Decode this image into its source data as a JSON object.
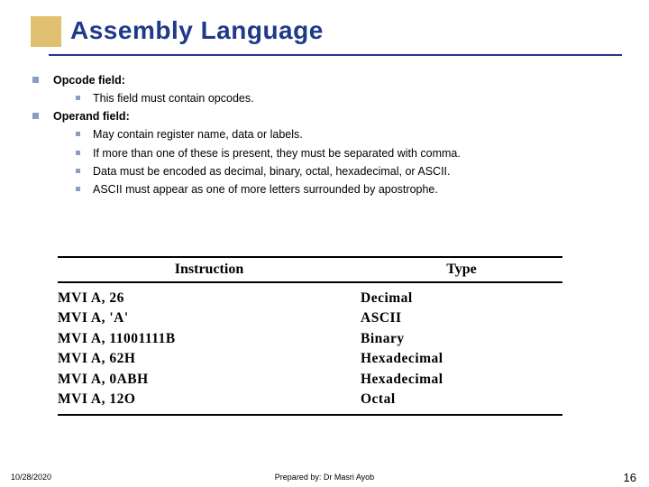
{
  "title": "Assembly Language",
  "sections": [
    {
      "heading": "Opcode field:",
      "items": [
        "This field must contain opcodes."
      ]
    },
    {
      "heading": "Operand field:",
      "items": [
        "May contain register name, data or labels.",
        "If more than one of these is present, they must be separated with comma.",
        "Data must be encoded as decimal, binary, octal, hexadecimal, or ASCII.",
        "ASCII must appear as one of more letters surrounded by apostrophe."
      ]
    }
  ],
  "table": {
    "headers": {
      "col1": "Instruction",
      "col2": "Type"
    },
    "rows": [
      {
        "col1": "MVI A, 26",
        "col2": "Decimal"
      },
      {
        "col1": "MVI A, 'A'",
        "col2": "ASCII"
      },
      {
        "col1": "MVI A, 11001111B",
        "col2": "Binary"
      },
      {
        "col1": "MVI A, 62H",
        "col2": "Hexadecimal"
      },
      {
        "col1": "MVI A, 0ABH",
        "col2": "Hexadecimal"
      },
      {
        "col1": "MVI A, 12O",
        "col2": "Octal"
      }
    ]
  },
  "footer": {
    "date": "10/28/2020",
    "prepared": "Prepared by: Dr Masri Ayob",
    "page": "16"
  }
}
